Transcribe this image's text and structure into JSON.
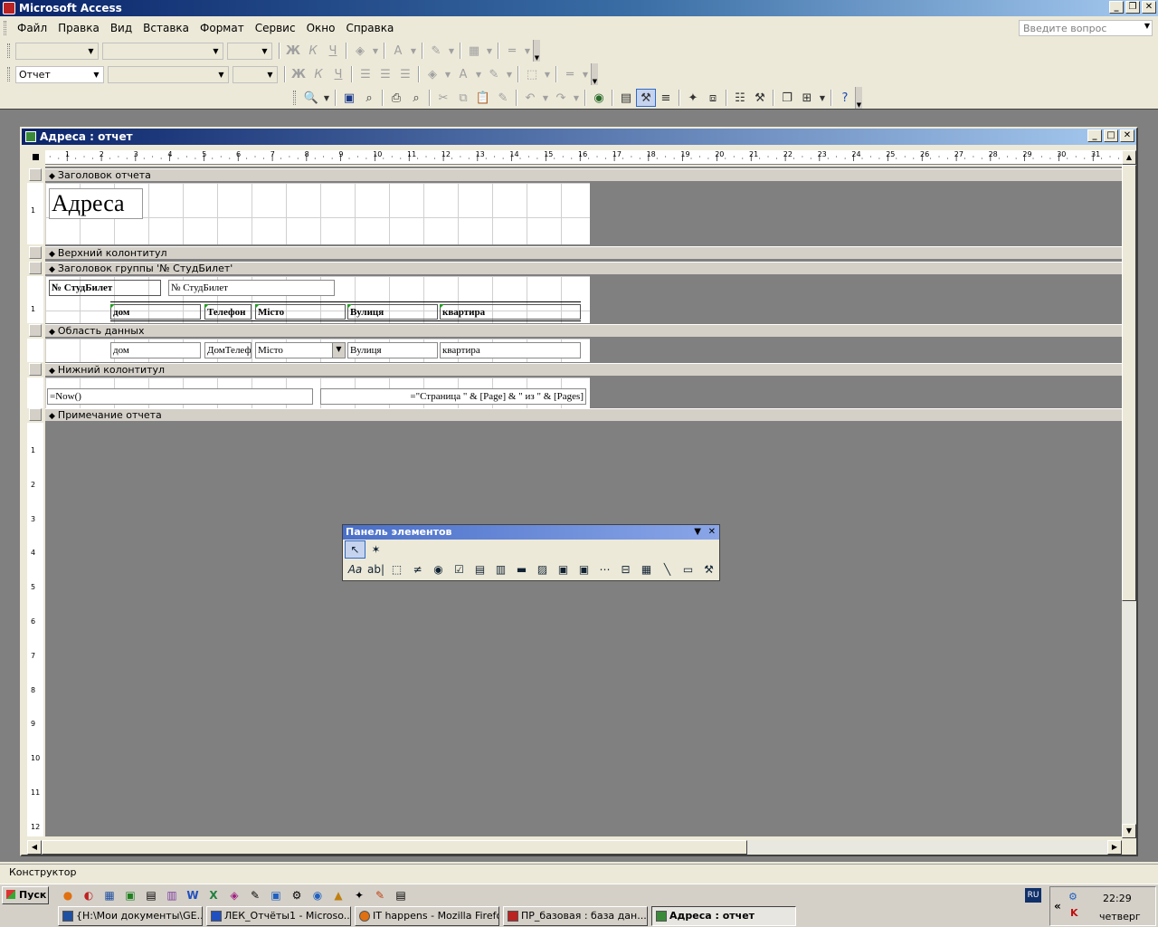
{
  "app": {
    "title": "Microsoft Access"
  },
  "menu": {
    "items": [
      "Файл",
      "Правка",
      "Вид",
      "Вставка",
      "Формат",
      "Сервис",
      "Окно",
      "Справка"
    ]
  },
  "ask_box": {
    "placeholder": "Введите вопрос"
  },
  "toolbar2": {
    "object_combo": "Отчет"
  },
  "report_window": {
    "title": "Адреса : отчет"
  },
  "ruler": {
    "marks": [
      "1",
      "2",
      "3",
      "4",
      "5",
      "6",
      "7",
      "8",
      "9",
      "10",
      "11",
      "12",
      "13",
      "14",
      "15",
      "16",
      "17",
      "18",
      "19",
      "20",
      "21",
      "22",
      "23",
      "24",
      "25",
      "26",
      "27",
      "28",
      "29",
      "30",
      "31"
    ]
  },
  "vruler_marks": [
    "1",
    "2",
    "3",
    "4",
    "5",
    "6",
    "7",
    "8",
    "9",
    "10",
    "11",
    "12"
  ],
  "sections": {
    "report_header": "Заголовок отчета",
    "page_header": "Верхний колонтитул",
    "group_header": "Заголовок группы '№ СтудБилет'",
    "detail": "Область данных",
    "page_footer": "Нижний колонтитул",
    "report_footer": "Примечание отчета"
  },
  "controls": {
    "title_label": "Адреса",
    "group_label": "№ СтудБилет",
    "group_field": "№ СтудБилет",
    "col_dom": "дом",
    "col_phone": "Телефон",
    "col_city": "Місто",
    "col_street": "Вулиця",
    "col_apt": "квартира",
    "fld_dom": "дом",
    "fld_phone": "ДомТелеф",
    "fld_city": "Місто",
    "fld_street": "Вулиця",
    "fld_apt": "квартира",
    "footer_now": "=Now()",
    "footer_pages": "=\"Страница \" & [Page] & \" из \" & [Pages]"
  },
  "toolbox": {
    "title": "Панель элементов"
  },
  "status": {
    "text": "Конструктор"
  },
  "taskbar": {
    "start": "Пуск",
    "tasks": [
      "{H:\\Мои документы\\GE...",
      "ЛЕК_Отчёты1 - Microso...",
      "IT happens - Mozilla Firefox",
      "ПР_базовая : база дан...",
      "Адреса : отчет"
    ],
    "lang": "RU",
    "time": "22:29",
    "day": "четверг"
  }
}
